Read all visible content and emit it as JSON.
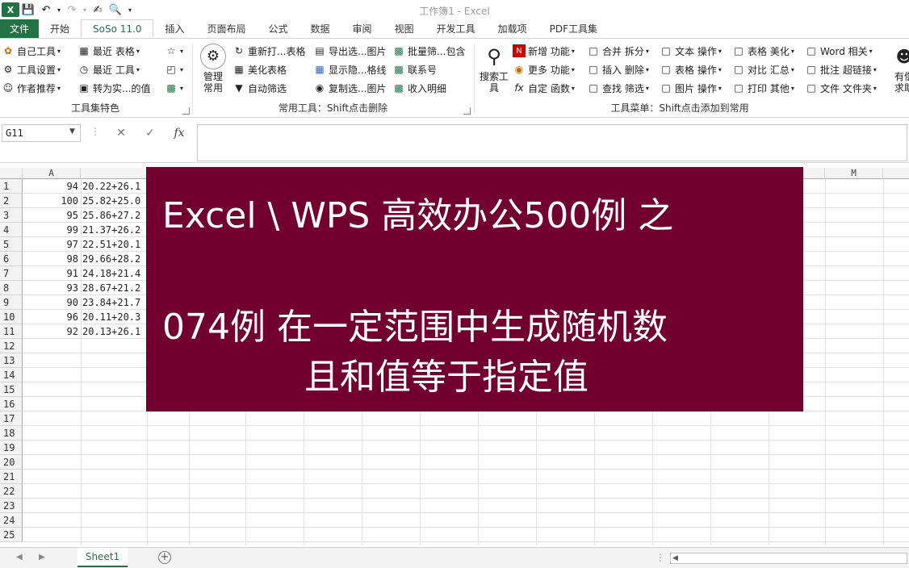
{
  "window": {
    "title": "工作簿1 - Excel"
  },
  "quick_access": [
    "save-icon",
    "undo-icon",
    "redo-icon",
    "touch-icon",
    "print-preview-icon",
    "customize-icon"
  ],
  "tabs": [
    "文件",
    "开始",
    "SoSo 11.0",
    "插入",
    "页面布局",
    "公式",
    "数据",
    "审阅",
    "视图",
    "开发工具",
    "加载项",
    "PDF工具集"
  ],
  "ribbon": {
    "group1": {
      "label": "工具集特色",
      "items": [
        "自己工具",
        "工具设置",
        "作者推荐",
        "最近 表格",
        "最近 工具",
        "转为实...的值"
      ]
    },
    "group2": {
      "manage_label": "管理\n常用",
      "label": "常用工具：Shift点击删除",
      "items": [
        "重新打...表格",
        "美化表格",
        "自动筛选",
        "导出选...图片",
        "显示隐...格线",
        "复制选...图片",
        "批量筛...包含",
        "联系号",
        "收入明细"
      ]
    },
    "group3": {
      "search_label": "搜索工\n具",
      "label": "工具菜单：Shift点击添加到常用",
      "items": [
        "新增 功能",
        "更多 功能",
        "自定 函数",
        "合并 拆分",
        "插入 删除",
        "查找 筛选",
        "文本 操作",
        "表格 操作",
        "图片 操作",
        "表格 美化",
        "对比 汇总",
        "打印 其他",
        "Word 相关",
        "批注 超链接",
        "文件 文件夹"
      ]
    },
    "group4": {
      "label": "有偿求助"
    }
  },
  "formula_bar": {
    "name_box": "G11",
    "cancel": "✕",
    "enter": "✓",
    "fx": "fx",
    "value": ""
  },
  "columns": [
    "A",
    "M"
  ],
  "rows": [
    "1",
    "2",
    "3",
    "4",
    "5",
    "6",
    "7",
    "8",
    "9",
    "10",
    "11",
    "12",
    "13",
    "14",
    "15",
    "16",
    "17",
    "18",
    "19",
    "20",
    "21",
    "22",
    "23",
    "24",
    "25"
  ],
  "cells": [
    {
      "a": "94",
      "b": "20.22+26.1"
    },
    {
      "a": "100",
      "b": "25.82+25.0"
    },
    {
      "a": "95",
      "b": "25.86+27.2"
    },
    {
      "a": "99",
      "b": "21.37+26.2"
    },
    {
      "a": "97",
      "b": "22.51+20.1"
    },
    {
      "a": "98",
      "b": "29.66+28.2"
    },
    {
      "a": "91",
      "b": "24.18+21.4"
    },
    {
      "a": "93",
      "b": "28.67+21.2"
    },
    {
      "a": "90",
      "b": "23.84+21.7"
    },
    {
      "a": "96",
      "b": "20.11+20.3"
    },
    {
      "a": "92",
      "b": "20.13+26.1"
    }
  ],
  "banner": {
    "line1": "Excel \\ WPS 高效办公500例 之",
    "line2": "074例 在一定范围中生成随机数",
    "line3": "且和值等于指定值",
    "color": "#72002f"
  },
  "sheet": {
    "tab": "Sheet1",
    "add": "+"
  },
  "colors": {
    "excel_green": "#217346"
  }
}
